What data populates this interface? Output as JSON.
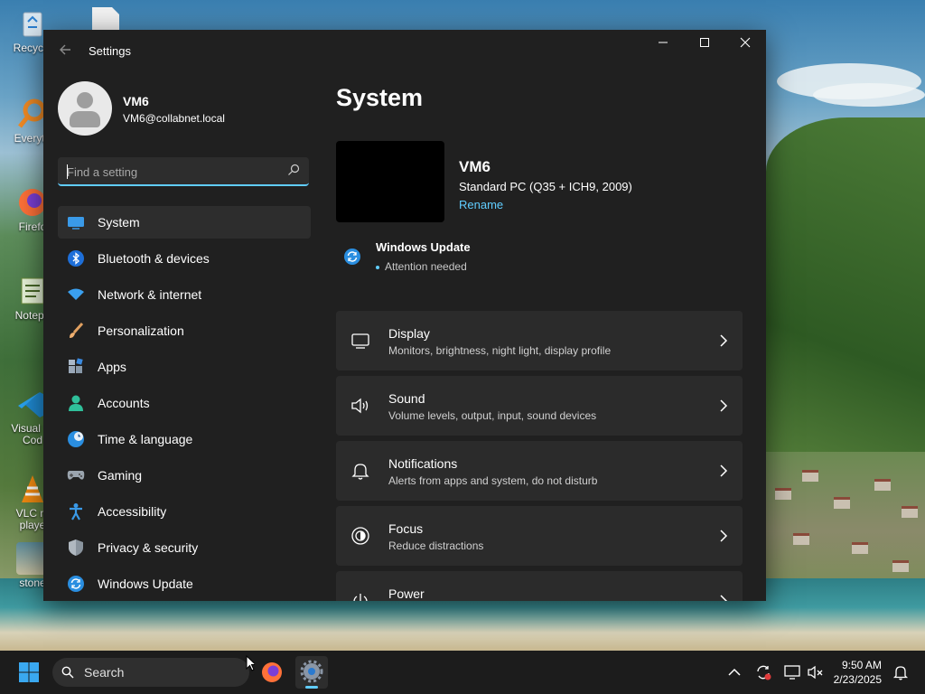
{
  "desktop": {
    "icons": [
      {
        "label": "Recycle",
        "icon": "recycle-bin-icon"
      },
      {
        "label": "Everyth",
        "icon": "everything-search-icon"
      },
      {
        "label": "Firefo",
        "icon": "firefox-icon"
      },
      {
        "label": "Notepa",
        "icon": "notepad-icon"
      },
      {
        "label": "Visual St\nCod",
        "icon": "vscode-icon"
      },
      {
        "label": "VLC m\nplaye",
        "icon": "vlc-icon"
      },
      {
        "label": "stone",
        "icon": "image-file-icon"
      }
    ]
  },
  "window": {
    "title": "Settings",
    "controls": {
      "minimize": "—",
      "maximize": "□",
      "close": "✕"
    }
  },
  "profile": {
    "name": "VM6",
    "email": "VM6@collabnet.local"
  },
  "search": {
    "placeholder": "Find a setting"
  },
  "nav": {
    "items": [
      {
        "label": "System",
        "icon": "system-display-icon",
        "active": true
      },
      {
        "label": "Bluetooth & devices",
        "icon": "bluetooth-icon"
      },
      {
        "label": "Network & internet",
        "icon": "wifi-icon"
      },
      {
        "label": "Personalization",
        "icon": "paintbrush-icon"
      },
      {
        "label": "Apps",
        "icon": "apps-icon"
      },
      {
        "label": "Accounts",
        "icon": "person-icon"
      },
      {
        "label": "Time & language",
        "icon": "globe-clock-icon"
      },
      {
        "label": "Gaming",
        "icon": "gamepad-icon"
      },
      {
        "label": "Accessibility",
        "icon": "accessibility-icon"
      },
      {
        "label": "Privacy & security",
        "icon": "shield-icon"
      },
      {
        "label": "Windows Update",
        "icon": "sync-icon"
      }
    ]
  },
  "main": {
    "title": "System",
    "device": {
      "name": "VM6",
      "model": "Standard PC (Q35 + ICH9, 2009)",
      "rename": "Rename"
    },
    "update": {
      "title": "Windows Update",
      "status": "Attention needed"
    },
    "cards": [
      {
        "title": "Display",
        "subtitle": "Monitors, brightness, night light, display profile",
        "icon": "monitor-icon"
      },
      {
        "title": "Sound",
        "subtitle": "Volume levels, output, input, sound devices",
        "icon": "speaker-icon"
      },
      {
        "title": "Notifications",
        "subtitle": "Alerts from apps and system, do not disturb",
        "icon": "bell-icon"
      },
      {
        "title": "Focus",
        "subtitle": "Reduce distractions",
        "icon": "focus-icon"
      },
      {
        "title": "Power",
        "subtitle": "",
        "icon": "power-icon"
      }
    ]
  },
  "taskbar": {
    "search_label": "Search",
    "time": "9:50 AM",
    "date": "2/23/2025"
  },
  "colors": {
    "accent": "#60cdff",
    "window_bg": "#202020",
    "card_bg": "#2b2b2b",
    "taskbar_bg": "#1c1c1c"
  }
}
